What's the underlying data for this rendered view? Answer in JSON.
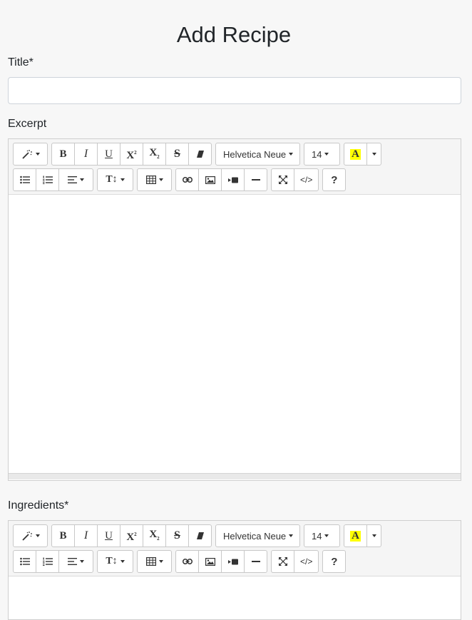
{
  "page": {
    "title": "Add Recipe"
  },
  "fields": {
    "title": {
      "label": "Title*",
      "value": "",
      "placeholder": ""
    },
    "excerpt": {
      "label": "Excerpt"
    },
    "ingredients": {
      "label": "Ingredients*"
    }
  },
  "toolbar": {
    "font_family": "Helvetica Neue",
    "font_size": "14",
    "bold": "B",
    "italic": "I",
    "underline": "U",
    "superscript": "X",
    "superscript_mark": "2",
    "subscript": "X",
    "subscript_mark": "2",
    "strikethrough": "S",
    "highlight": "A",
    "height_label": "T",
    "help": "?",
    "code": "</>",
    "highlight_color": "#ffff00",
    "icons": [
      "magic-icon",
      "eraser-icon",
      "unordered-list-icon",
      "ordered-list-icon",
      "align-left-icon",
      "line-height-icon",
      "table-icon",
      "link-icon",
      "picture-icon",
      "video-icon",
      "horizontal-rule-icon",
      "fullscreen-icon",
      "code-view-icon"
    ]
  }
}
